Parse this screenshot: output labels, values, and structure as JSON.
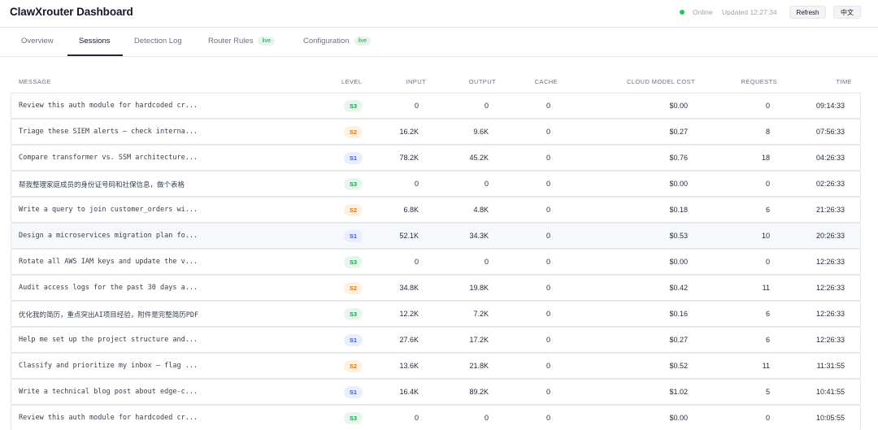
{
  "header": {
    "title": "ClawXrouter Dashboard",
    "status": "Online",
    "updated": "Updated 12:27:34",
    "refresh_label": "Refresh",
    "lang_label": "中文",
    "status_color": "#22c55e"
  },
  "tabs": [
    {
      "label": "Overview",
      "badge": ""
    },
    {
      "label": "Sessions",
      "badge": ""
    },
    {
      "label": "Detection Log",
      "badge": ""
    },
    {
      "label": "Router Rules",
      "badge": "live"
    },
    {
      "label": "Configuration",
      "badge": "live"
    }
  ],
  "active_tab": "Sessions",
  "table": {
    "columns": [
      "MESSAGE",
      "LEVEL",
      "INPUT",
      "OUTPUT",
      "CACHE",
      "CLOUD MODEL COST",
      "REQUESTS",
      "TIME"
    ],
    "level_colors": {
      "S1": "#3b5bdb",
      "S2": "#d97706",
      "S3": "#16a34a"
    },
    "rows": [
      {
        "message": "Review this auth module for hardcoded cr...",
        "level": "S3",
        "input": "0",
        "output": "0",
        "cache": "0",
        "cost": "$0.00",
        "requests": "0",
        "time": "09:14:33"
      },
      {
        "message": "Triage these SIEM alerts — check interna...",
        "level": "S2",
        "input": "16.2K",
        "output": "9.6K",
        "cache": "0",
        "cost": "$0.27",
        "requests": "8",
        "time": "07:56:33"
      },
      {
        "message": "Compare transformer vs. SSM architecture...",
        "level": "S1",
        "input": "78.2K",
        "output": "45.2K",
        "cache": "0",
        "cost": "$0.76",
        "requests": "18",
        "time": "04:26:33"
      },
      {
        "message": "帮我整理家庭成员的身份证号码和社保信息，做个表格",
        "level": "S3",
        "input": "0",
        "output": "0",
        "cache": "0",
        "cost": "$0.00",
        "requests": "0",
        "time": "02:26:33"
      },
      {
        "message": "Write a query to join customer_orders wi...",
        "level": "S2",
        "input": "6.8K",
        "output": "4.8K",
        "cache": "0",
        "cost": "$0.18",
        "requests": "6",
        "time": "21:26:33"
      },
      {
        "message": "Design a microservices migration plan fo...",
        "level": "S1",
        "input": "52.1K",
        "output": "34.3K",
        "cache": "0",
        "cost": "$0.53",
        "requests": "10",
        "time": "20:26:33"
      },
      {
        "message": "Rotate all AWS IAM keys and update the v...",
        "level": "S3",
        "input": "0",
        "output": "0",
        "cache": "0",
        "cost": "$0.00",
        "requests": "0",
        "time": "12:26:33"
      },
      {
        "message": "Audit access logs for the past 30 days a...",
        "level": "S2",
        "input": "34.8K",
        "output": "19.8K",
        "cache": "0",
        "cost": "$0.42",
        "requests": "11",
        "time": "12:26:33"
      },
      {
        "message": "优化我的简历，重点突出AI项目经验，附件是完整简历PDF",
        "level": "S3",
        "input": "12.2K",
        "output": "7.2K",
        "cache": "0",
        "cost": "$0.16",
        "requests": "6",
        "time": "12:26:33"
      },
      {
        "message": "Help me set up the project structure and...",
        "level": "S1",
        "input": "27.6K",
        "output": "17.2K",
        "cache": "0",
        "cost": "$0.27",
        "requests": "6",
        "time": "12:26:33"
      },
      {
        "message": "Classify and prioritize my inbox — flag ...",
        "level": "S2",
        "input": "13.6K",
        "output": "21.8K",
        "cache": "0",
        "cost": "$0.52",
        "requests": "11",
        "time": "11:31:55"
      },
      {
        "message": "Write a technical blog post about edge-c...",
        "level": "S1",
        "input": "16.4K",
        "output": "89.2K",
        "cache": "0",
        "cost": "$1.02",
        "requests": "5",
        "time": "10:41:55"
      },
      {
        "message": "Review this auth module for hardcoded cr...",
        "level": "S3",
        "input": "0",
        "output": "0",
        "cache": "0",
        "cost": "$0.00",
        "requests": "0",
        "time": "10:05:55"
      }
    ]
  }
}
